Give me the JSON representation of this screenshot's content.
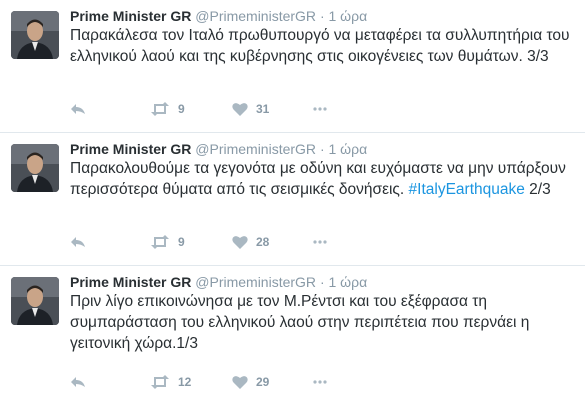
{
  "tweets": [
    {
      "name": "Prime Minister GR",
      "handle": "@PrimeministerGR",
      "dot": "·",
      "time": "1 ώρα",
      "text": "Παρακάλεσα τον Ιταλό πρωθυπουργό να μεταφέρει τα συλλυπητήρια του ελληνικού λαού και της κυβέρνησης στις οικογένειες των θυμάτων. 3/3",
      "hashtag": "",
      "suffix": "",
      "retweets": "9",
      "likes": "31"
    },
    {
      "name": "Prime Minister GR",
      "handle": "@PrimeministerGR",
      "dot": "·",
      "time": "1 ώρα",
      "text": "Παρακολουθούμε τα γεγονότα με οδύνη και ευχόμαστε να μην υπάρξουν περισσότερα θύματα από τις σεισμικές δονήσεις.",
      "hashtag": "#ItalyEarthquake",
      "suffix": " 2/3",
      "retweets": "9",
      "likes": "28"
    },
    {
      "name": "Prime Minister GR",
      "handle": "@PrimeministerGR",
      "dot": "·",
      "time": "1 ώρα",
      "text": "Πριν λίγο επικοινώνησα με τον Μ.Ρέντσι και του εξέφρασα τη συμπαράσταση του ελληνικού λαού στην περιπέτεια που περνάει η γειτονική χώρα.1/3",
      "hashtag": "",
      "suffix": "",
      "retweets": "12",
      "likes": "29"
    }
  ],
  "icons": {
    "reply": "reply-icon",
    "retweet": "retweet-icon",
    "like": "heart-icon",
    "more": "more-dots-icon"
  },
  "colors": {
    "hashtag": "#1b95e0",
    "muted": "#8899a6",
    "icon": "#aab8c2"
  }
}
